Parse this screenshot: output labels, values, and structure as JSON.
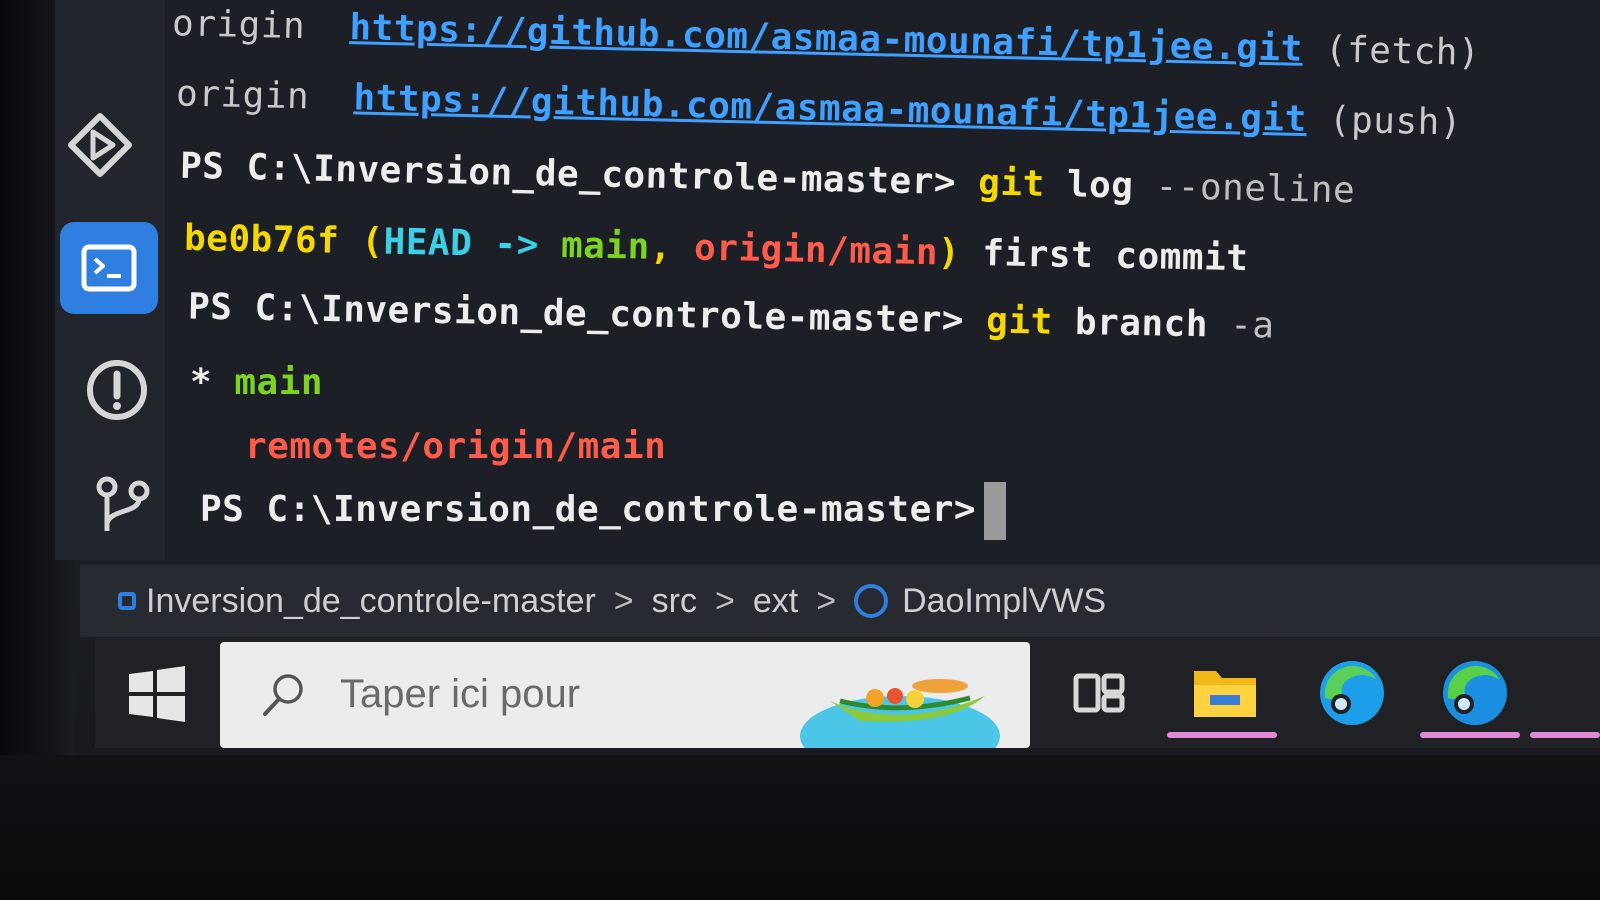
{
  "terminal": {
    "lines": [
      {
        "prefix": "origin",
        "url": "https://github.com/asmaa-mounafi/tp1jee.git",
        "suffix": "(fetch)"
      },
      {
        "prefix": "origin",
        "url": "https://github.com/asmaa-mounafi/tp1jee.git",
        "suffix": "(push)"
      }
    ],
    "prompt": "PS C:\\Inversion_de_controle-master>",
    "cmd_log": {
      "git": "git",
      "sub": "log",
      "arg": "--oneline"
    },
    "log_entry": {
      "hash": "be0b76f",
      "open": "(",
      "head": "HEAD",
      "arrow": "->",
      "branch": "main",
      "comma": ",",
      "remote": "origin/main",
      "close": ")",
      "message": "first commit"
    },
    "cmd_branch": {
      "git": "git",
      "sub": "branch",
      "arg": "-a"
    },
    "branch_current_marker": "*",
    "branch_current": "main",
    "branch_remote": "remotes/origin/main"
  },
  "breadcrumb": {
    "items": [
      "Inversion_de_controle-master",
      "src",
      "ext",
      "DaoImplVWS"
    ],
    "separator": ">"
  },
  "taskbar": {
    "search_placeholder": "Taper ici pour"
  },
  "colors": {
    "accent": "#2f7fe0",
    "url": "#3fa0ff",
    "git": "#f5d800",
    "branch": "#7cd321",
    "remote": "#ff5b4a"
  },
  "icons": [
    "run-debug-icon",
    "terminal-icon",
    "problems-icon",
    "source-control-icon",
    "windows-start-icon",
    "search-icon",
    "task-view-icon",
    "file-explorer-icon",
    "edge-icon",
    "edge-dev-icon"
  ]
}
